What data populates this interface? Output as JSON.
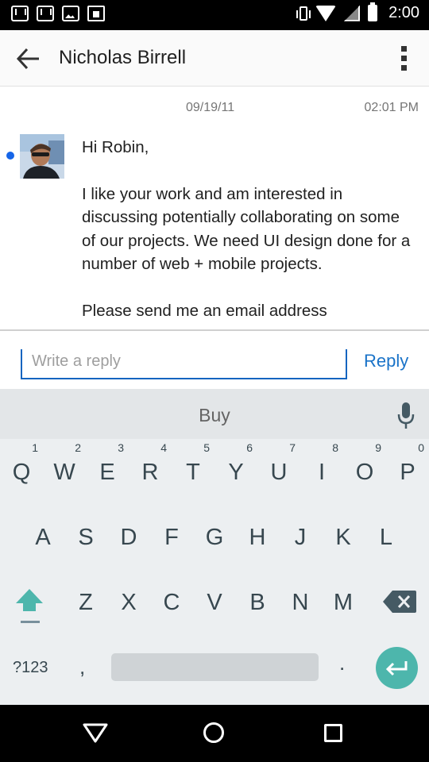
{
  "status_bar": {
    "time": "2:00",
    "icons": [
      "mail-icon",
      "inbox-icon",
      "image-icon",
      "bag-icon",
      "vibrate-icon",
      "wifi-icon",
      "signal-icon",
      "battery-icon"
    ]
  },
  "app_bar": {
    "title": "Nicholas Birrell",
    "back_icon": "arrow-back-icon",
    "menu_icon": "overflow-menu-icon"
  },
  "message": {
    "date": "09/19/11",
    "time": "02:01 PM",
    "unread": true,
    "unread_color": "#1565e8",
    "greeting": "Hi Robin,",
    "paragraph": "I like your work and am interested in discussing potentially collaborating on some of our projects. We need UI design done for a number of web + mobile projects.",
    "cutoff_text": "Please send me an email address"
  },
  "reply": {
    "placeholder": "Write a reply",
    "value": "",
    "button_label": "Reply",
    "accent_color": "#1a73c8"
  },
  "keyboard": {
    "suggestion": "Buy",
    "row1": [
      {
        "key": "Q",
        "hint": "1"
      },
      {
        "key": "W",
        "hint": "2"
      },
      {
        "key": "E",
        "hint": "3"
      },
      {
        "key": "R",
        "hint": "4"
      },
      {
        "key": "T",
        "hint": "5"
      },
      {
        "key": "Y",
        "hint": "6"
      },
      {
        "key": "U",
        "hint": "7"
      },
      {
        "key": "I",
        "hint": "8"
      },
      {
        "key": "O",
        "hint": "9"
      },
      {
        "key": "P",
        "hint": "0"
      }
    ],
    "row2": [
      "A",
      "S",
      "D",
      "F",
      "G",
      "H",
      "J",
      "K",
      "L"
    ],
    "row3": [
      "Z",
      "X",
      "C",
      "V",
      "B",
      "N",
      "M"
    ],
    "symbols_label": "?123",
    "comma": ",",
    "period": ".",
    "enter_color": "#4db6ac",
    "shift_color": "#4db6ac"
  },
  "nav_bar": {
    "icons": [
      "back-triangle-icon",
      "home-circle-icon",
      "recents-square-icon"
    ]
  }
}
